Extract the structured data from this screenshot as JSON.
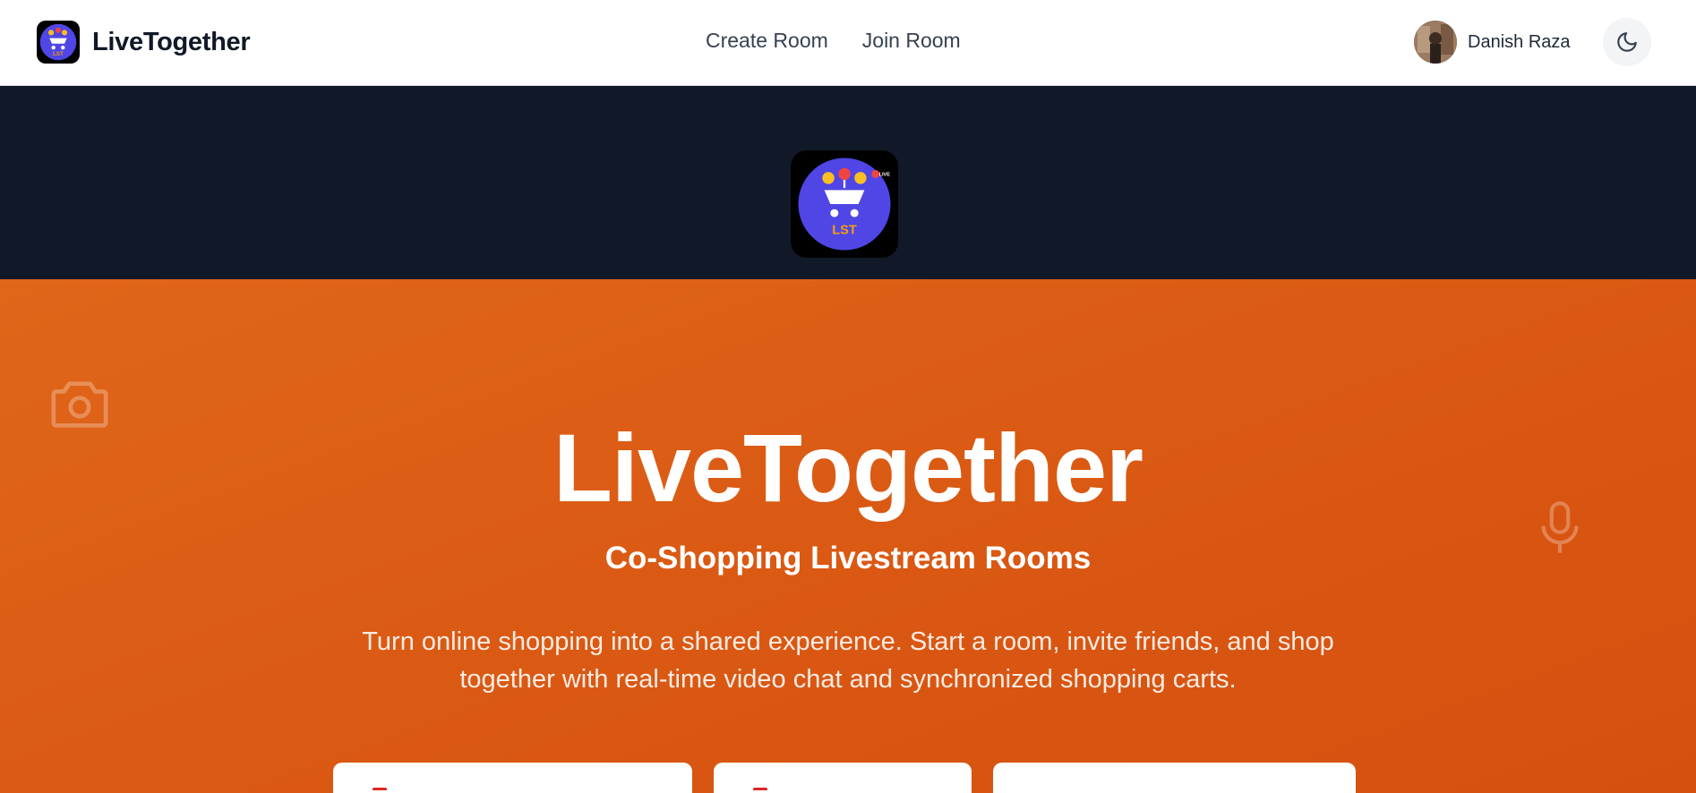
{
  "navbar": {
    "brand_name": "LiveTogether",
    "links": [
      {
        "label": "Create Room"
      },
      {
        "label": "Join Room"
      }
    ],
    "user": {
      "name": "Danish Raza"
    }
  },
  "hero": {
    "logo_text": "LST",
    "logo_badge": "LIVE",
    "title": "LiveTogether",
    "subtitle": "Co-Shopping Livestream Rooms",
    "description": "Turn online shopping into a shared experience. Start a room, invite friends, and shop together with real-time video chat and synchronized shopping carts."
  },
  "colors": {
    "hero_orange": "#d95712",
    "dark_band": "#111827",
    "logo_purple": "#4f46e5",
    "logo_yellow": "#fbbf24",
    "logo_red": "#ef4444"
  },
  "icons": [
    "camera-icon",
    "microphone-icon",
    "moon-icon",
    "cart-icon"
  ]
}
